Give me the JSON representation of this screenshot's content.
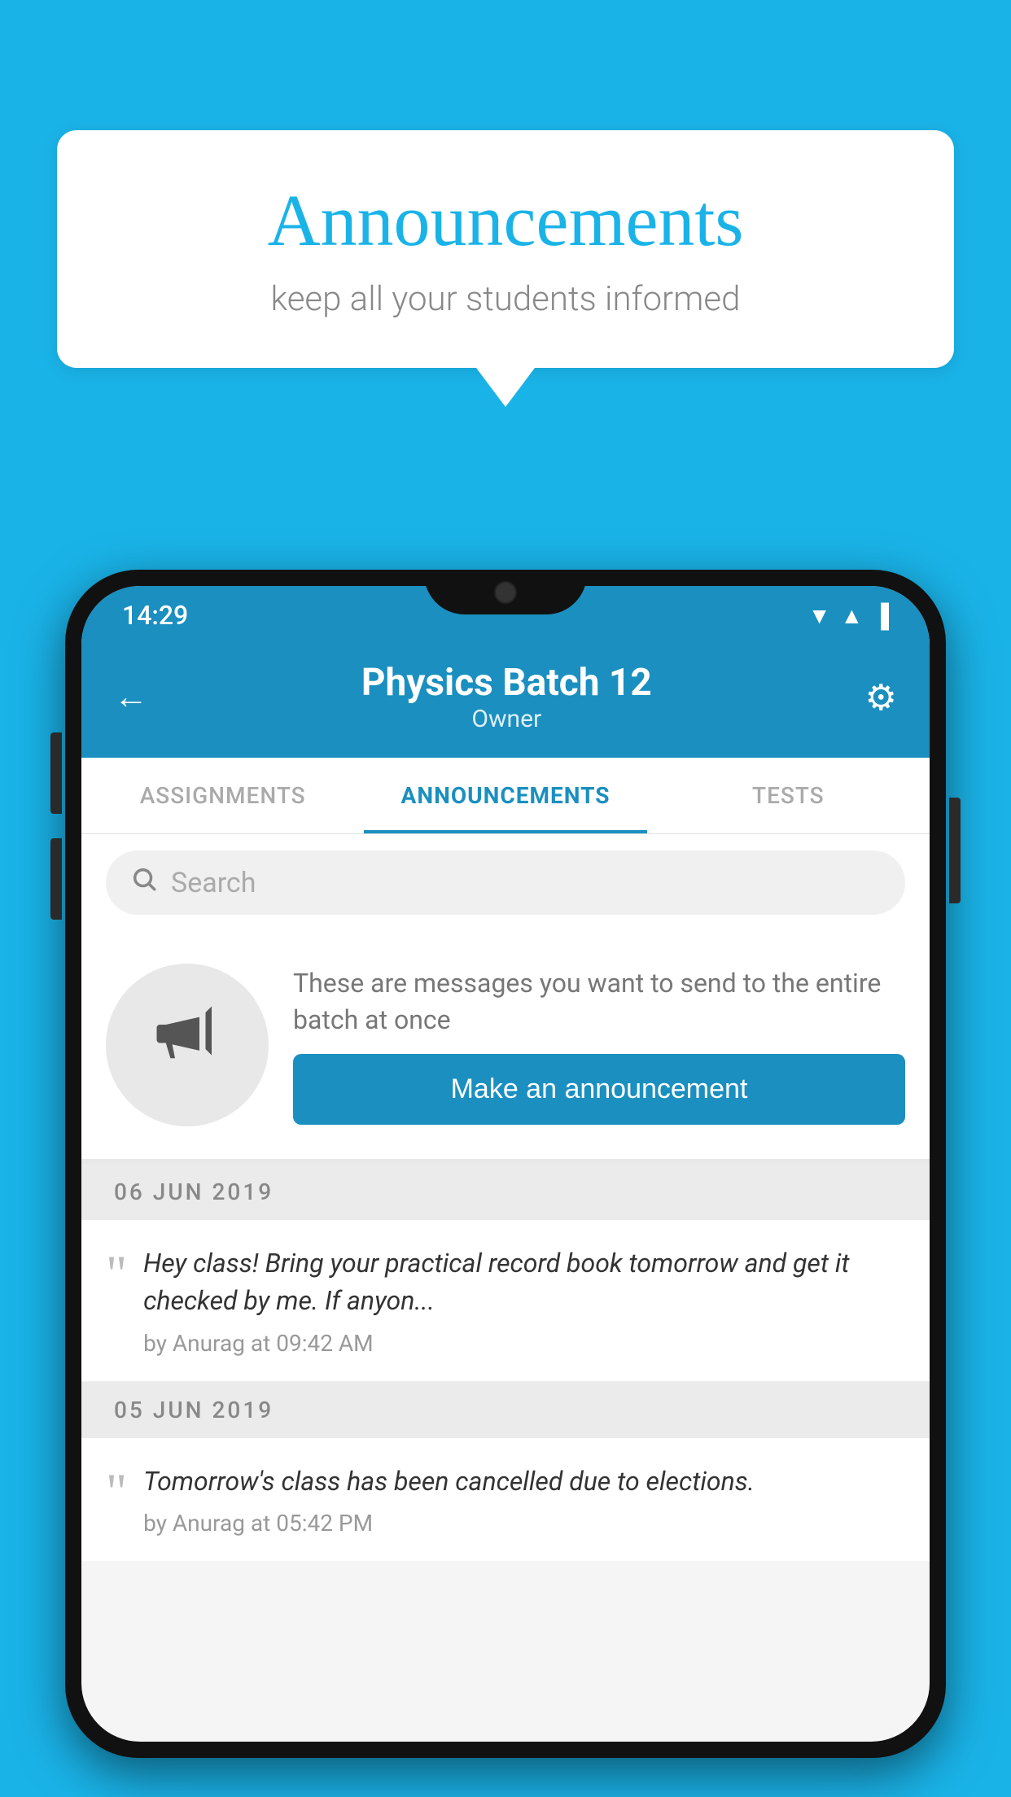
{
  "background_color": "#1ab3e8",
  "speech_bubble": {
    "title": "Announcements",
    "subtitle": "keep all your students informed"
  },
  "status_bar": {
    "time": "14:29",
    "icons": [
      "wifi",
      "signal",
      "battery"
    ]
  },
  "header": {
    "title": "Physics Batch 12",
    "subtitle": "Owner",
    "back_label": "←",
    "settings_label": "⚙"
  },
  "tabs": [
    {
      "label": "ASSIGNMENTS",
      "active": false
    },
    {
      "label": "ANNOUNCEMENTS",
      "active": true
    },
    {
      "label": "TESTS",
      "active": false
    }
  ],
  "search": {
    "placeholder": "Search",
    "icon": "🔍"
  },
  "promo": {
    "description": "These are messages you want to send to the entire batch at once",
    "button_label": "Make an announcement"
  },
  "announcements": [
    {
      "date_separator": "06  JUN  2019",
      "text": "Hey class! Bring your practical record book tomorrow and get it checked by me. If anyon...",
      "meta": "by Anurag at 09:42 AM"
    },
    {
      "date_separator": "05  JUN  2019",
      "text": "Tomorrow's class has been cancelled due to elections.",
      "meta": "by Anurag at 05:42 PM"
    }
  ]
}
